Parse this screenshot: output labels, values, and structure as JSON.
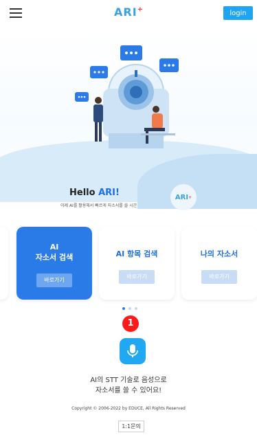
{
  "header": {
    "logo": "ARI",
    "logo_plus": "+",
    "login_label": "login"
  },
  "hello": {
    "title_prefix": "Hello ",
    "title_highlight": "ARI!",
    "subtitle": "이제 AI를 활용해서 빠르게 자소서를 쓸 시간",
    "badge_text": "ARI",
    "badge_plus": "+"
  },
  "cards": [
    {
      "title_line1": "AI",
      "title_line2": "자소서 검색",
      "button": "바로가기",
      "active": true
    },
    {
      "title_line1": "AI 항목 검색",
      "title_line2": "",
      "button": "바로가기",
      "active": false
    },
    {
      "title_line1": "나의 자소서",
      "title_line2": "",
      "button": "바로가기",
      "active": false
    }
  ],
  "carousel": {
    "page_count": 3,
    "current_page": 1
  },
  "marker": "1",
  "stt": {
    "line1": "AI의 STT 기술로 음성으로",
    "line2": "자소서를 쓸 수 있어요!"
  },
  "footer": {
    "copyright": "Copyright © 2006-2022 by EDUCE, All Rights Reserved",
    "inquiry_label": "1:1문의"
  },
  "colors": {
    "accent": "#2a7be7",
    "mic": "#21a8f3",
    "login": "#1fa5f0"
  }
}
